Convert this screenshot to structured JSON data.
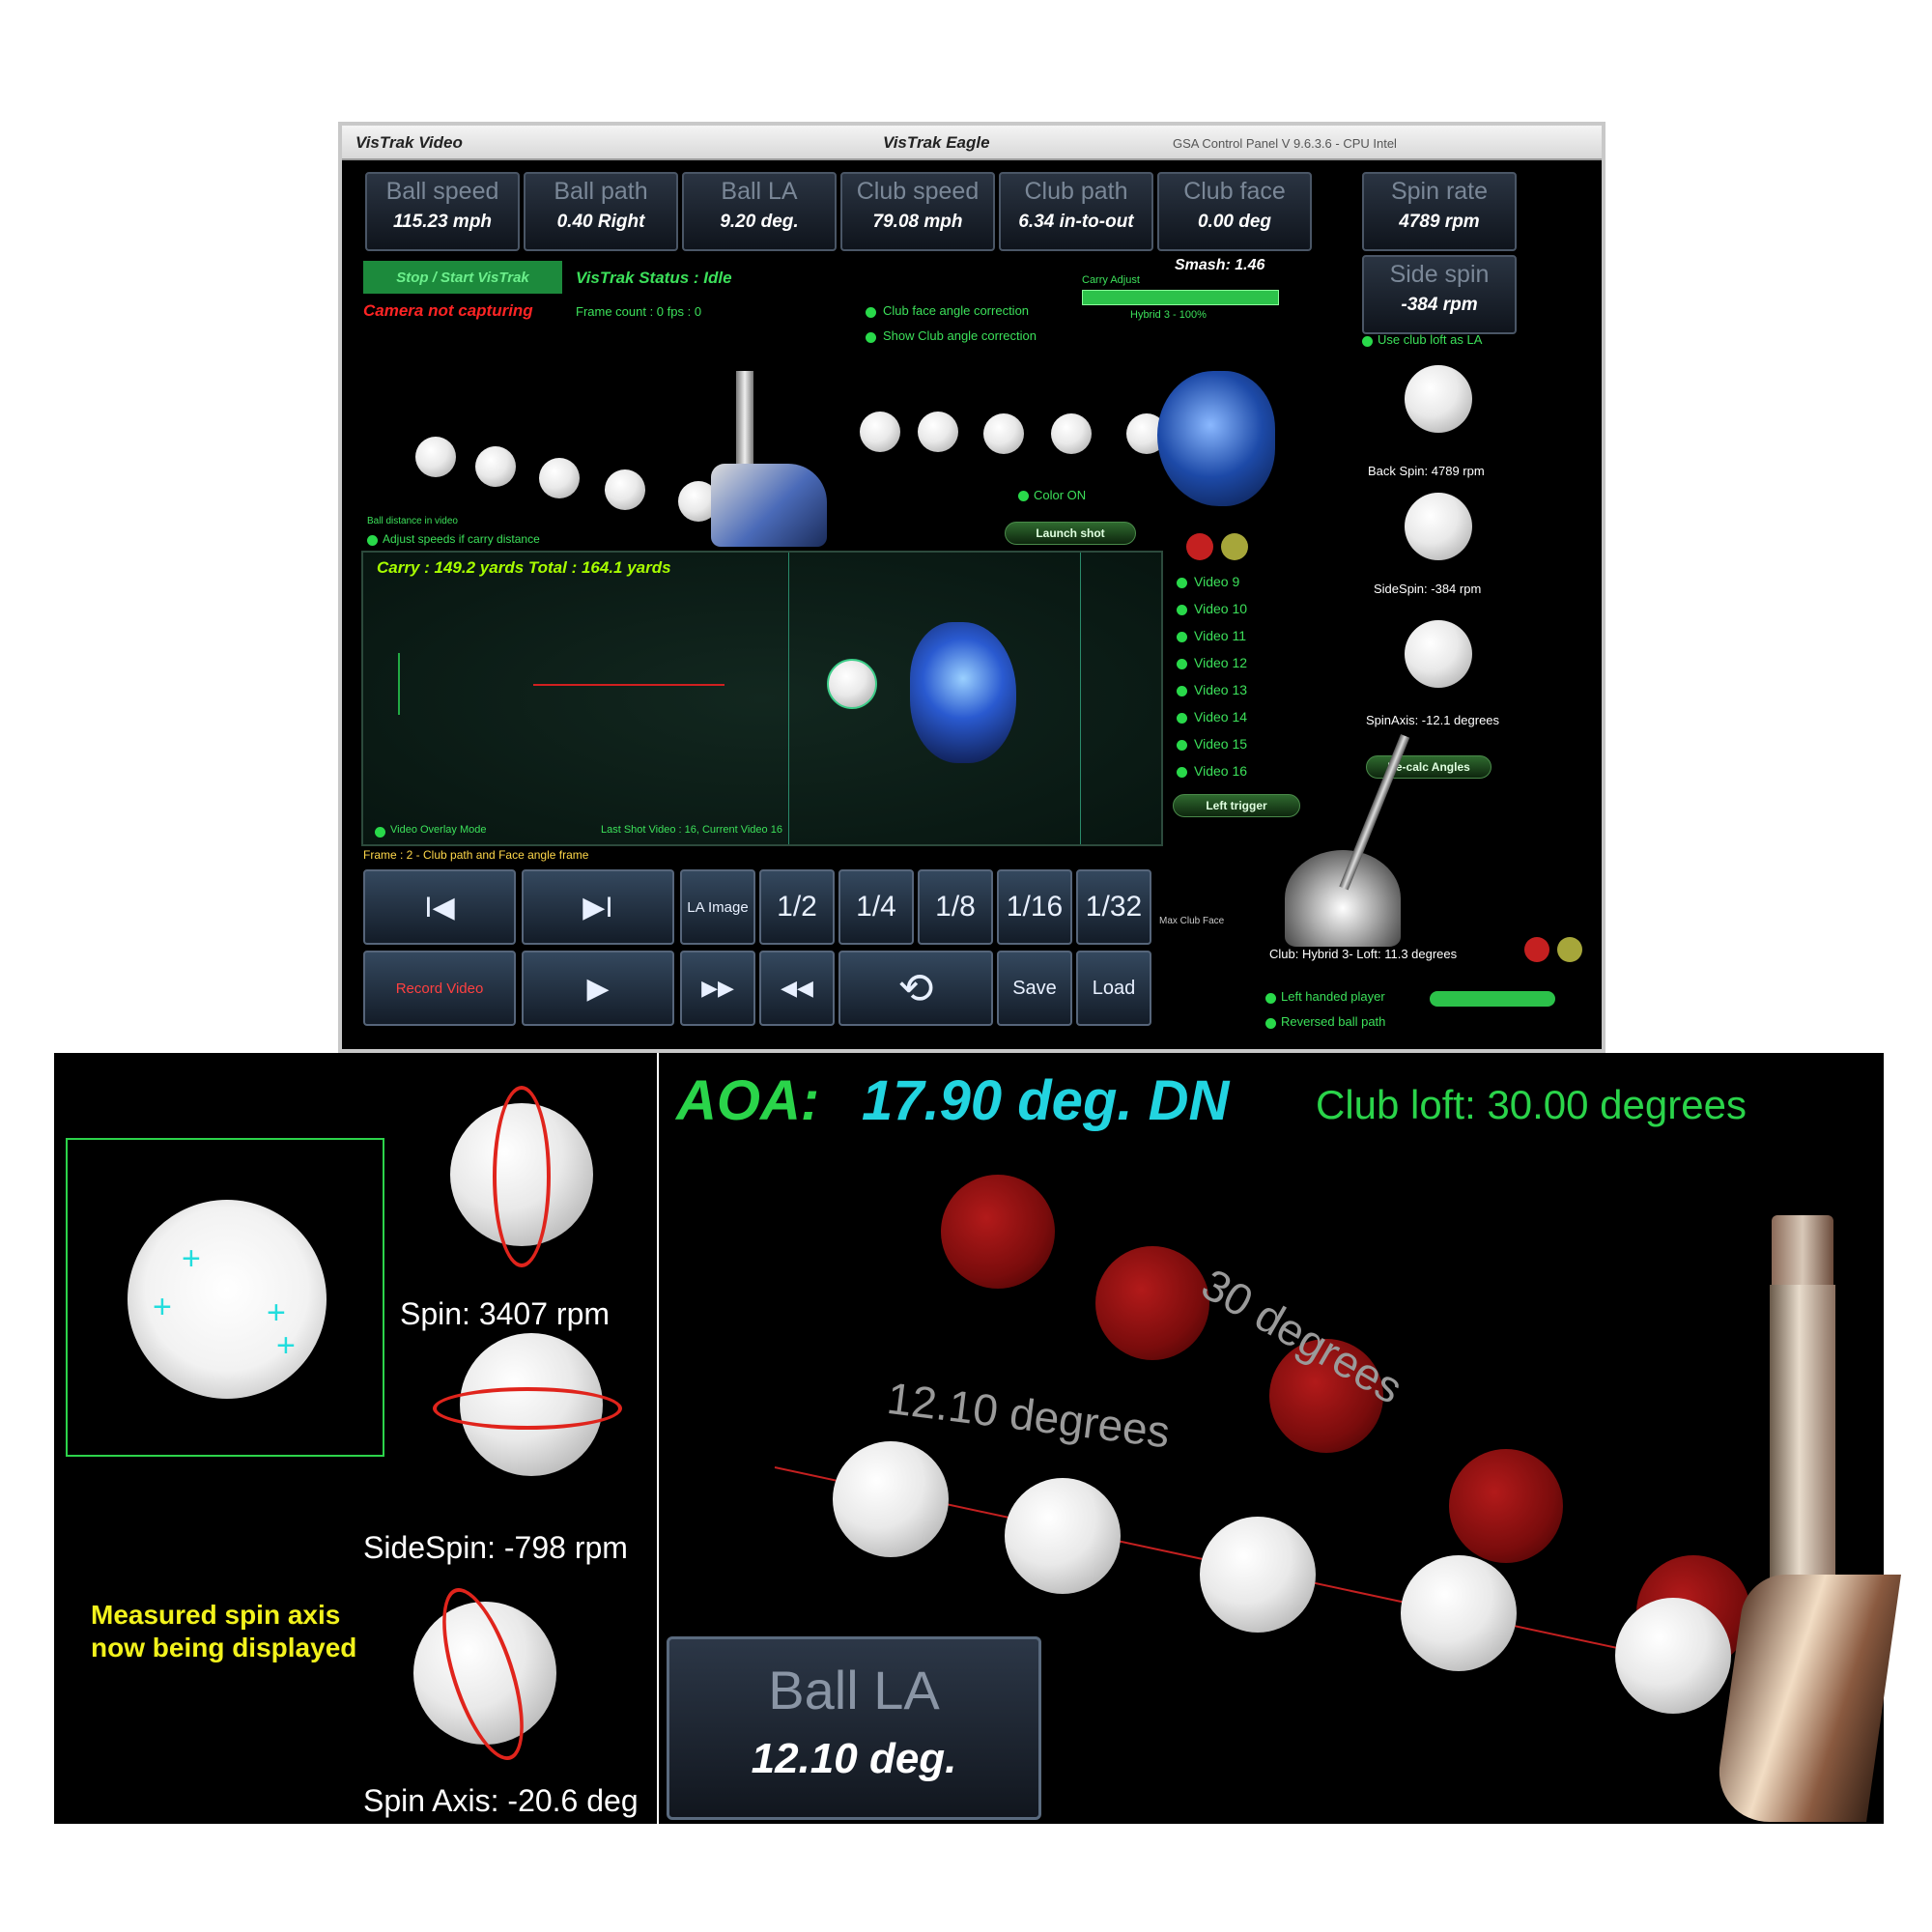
{
  "window": {
    "title_left": "VisTrak Video",
    "title_center": "VisTrak Eagle",
    "title_right": "GSA Control Panel V 9.6.3.6 - CPU Intel"
  },
  "metrics": [
    {
      "label": "Ball speed",
      "value": "115.23 mph"
    },
    {
      "label": "Ball path",
      "value": "0.40 Right"
    },
    {
      "label": "Ball LA",
      "value": "9.20 deg."
    },
    {
      "label": "Club speed",
      "value": "79.08 mph"
    },
    {
      "label": "Club path",
      "value": "6.34 in-to-out"
    },
    {
      "label": "Club face",
      "value": "0.00 deg"
    },
    {
      "label": "Spin rate",
      "value": "4789 rpm"
    },
    {
      "label": "Side spin",
      "value": "-384 rpm"
    }
  ],
  "status": {
    "start_button": "Stop / Start VisTrak",
    "vistrak_status": "VisTrak Status : Idle",
    "camera": "Camera not capturing",
    "frame_count": "Frame count : 0 fps : 0",
    "smash": "Smash: 1.46",
    "carry_adjust": "Carry Adjust",
    "hybrid": "Hybrid 3 - 100%",
    "club_face_correction": "Club face angle correction",
    "show_club_angle": "Show Club angle correction",
    "use_club_loft": "Use club loft as LA",
    "color_on": "Color ON",
    "launch_shot": "Launch shot",
    "adjust_speeds": "Adjust speeds if carry distance"
  },
  "spin_panel": {
    "back_spin": "Back Spin: 4789 rpm",
    "side_spin": "SideSpin: -384 rpm",
    "spin_axis": "SpinAxis: -12.1 degrees",
    "recalc": "Re-calc Angles",
    "left_trigger": "Left trigger"
  },
  "video": {
    "carry": "Carry : 149.2 yards  Total : 164.1 yards",
    "overlay_mode": "Video Overlay Mode",
    "last_shot": "Last Shot Video : 16, Current Video 16",
    "frame_info": "Frame : 2 - Club path and Face angle frame",
    "list": [
      "Video 9",
      "Video 10",
      "Video 11",
      "Video 12",
      "Video 13",
      "Video 14",
      "Video 15",
      "Video 16"
    ]
  },
  "controls": {
    "row1": [
      "I◀",
      "▶I",
      "LA Image",
      "1/2",
      "1/4",
      "1/8",
      "1/16",
      "1/32"
    ],
    "row2": [
      "Record Video",
      "▶",
      "▶▶",
      "◀◀",
      "⟲",
      "Save",
      "Load"
    ],
    "club_info": "Club: Hybrid 3- Loft: 11.3 degrees",
    "left_handed": "Left handed player",
    "reversed": "Reversed ball path",
    "max_club_face": "Max Club Face"
  },
  "bottom_left": {
    "spin": "Spin: 3407 rpm",
    "sidespin": "SideSpin: -798 rpm",
    "axis_note_line1": "Measured spin axis",
    "axis_note_line2": "now being displayed",
    "spin_axis": "Spin Axis: -20.6 deg"
  },
  "bottom_right": {
    "aoa_label": "AOA:",
    "aoa_value": "17.90 deg. DN",
    "club_loft": "Club loft: 30.00 degrees",
    "deg30": "30 degrees",
    "deg12": "12.10 degrees",
    "ball_la_label": "Ball LA",
    "ball_la_value": "12.10 deg."
  }
}
